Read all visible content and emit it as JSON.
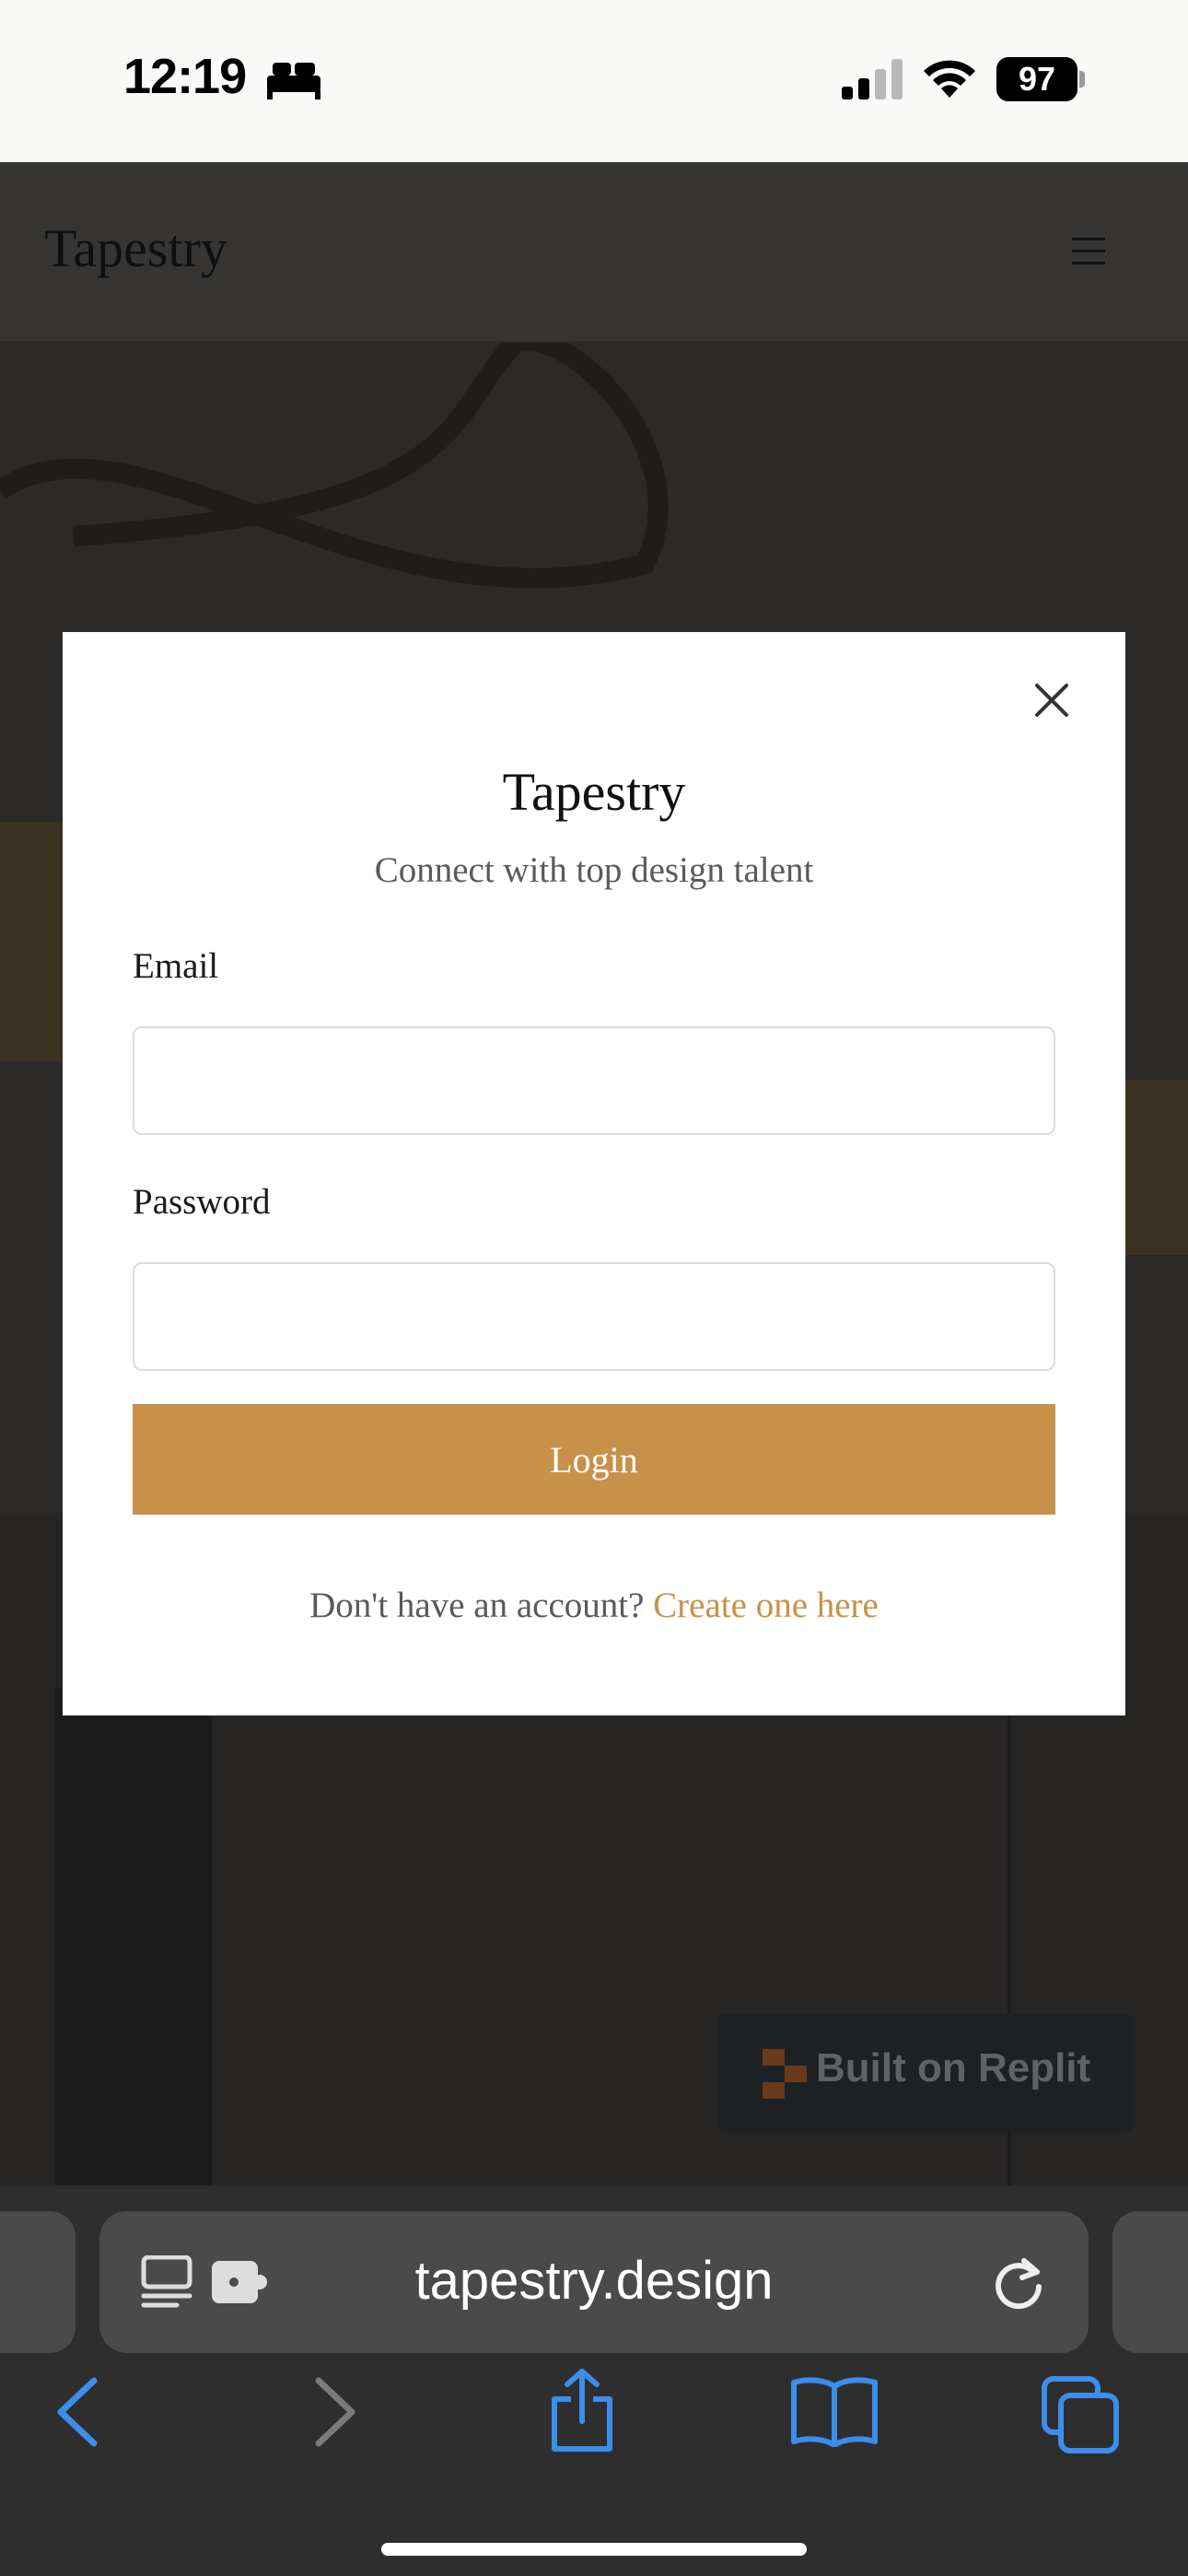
{
  "status_bar": {
    "time": "12:19",
    "battery_level": "97",
    "icons": [
      "bed-icon",
      "cellular-signal-icon",
      "wifi-icon",
      "battery-icon"
    ]
  },
  "site": {
    "logo": "Tapestry",
    "menu_icon": "hamburger-menu-icon",
    "badge_label": "Built on Replit"
  },
  "modal": {
    "title": "Tapestry",
    "subtitle": "Connect with top design talent",
    "email_label": "Email",
    "email_value": "",
    "password_label": "Password",
    "password_value": "",
    "login_label": "Login",
    "signup_prompt": "Don't have an account?",
    "signup_link": "Create one here",
    "close_icon": "close-icon"
  },
  "browser": {
    "url": "tapestry.design",
    "icons": [
      "reader-icon",
      "extension-icon",
      "reload-icon",
      "back-icon",
      "forward-icon",
      "share-icon",
      "bookmarks-icon",
      "tabs-icon"
    ]
  },
  "colors": {
    "accent": "#c8914a",
    "overlay": "#2e2d2c",
    "modal_bg": "#ffffff"
  }
}
